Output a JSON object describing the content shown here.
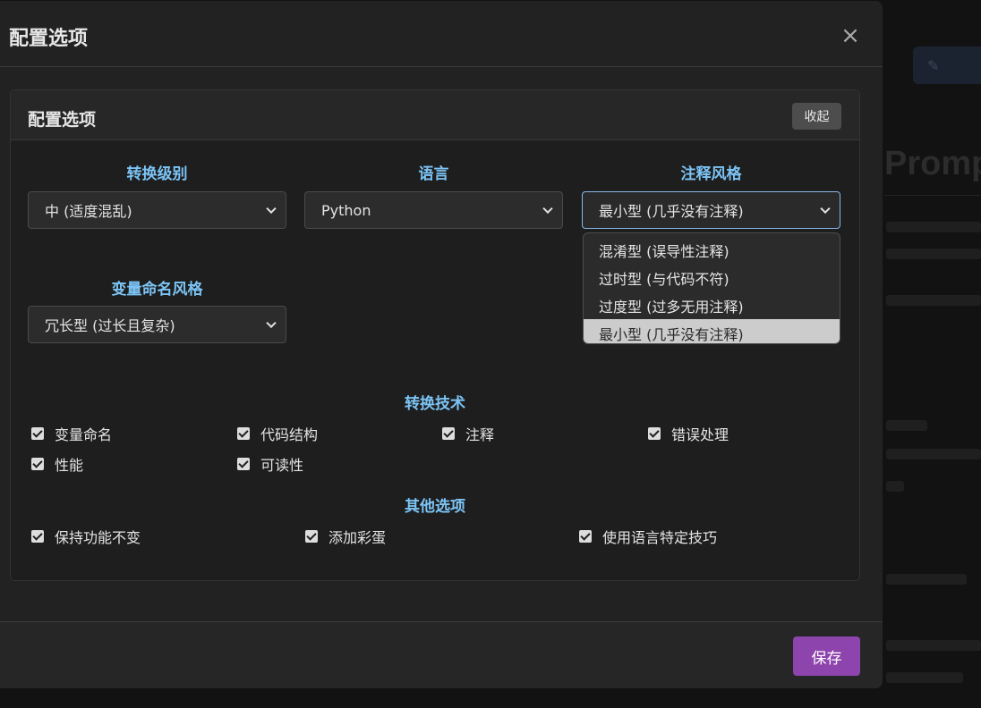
{
  "background": {
    "title_fragment": "Promp"
  },
  "modal": {
    "title": "配置选项",
    "close_label": "×",
    "card": {
      "title": "配置选项",
      "collapse_label": "收起",
      "fields": {
        "level": {
          "label": "转换级别",
          "value": "中 (适度混乱)"
        },
        "language": {
          "label": "语言",
          "value": "Python"
        },
        "comment_style": {
          "label": "注释风格",
          "value": "最小型 (几乎没有注释)",
          "options": [
            "混淆型 (误导性注释)",
            "过时型 (与代码不符)",
            "过度型 (过多无用注释)",
            "最小型 (几乎没有注释)"
          ],
          "selected_index": 3
        },
        "naming": {
          "label": "变量命名风格",
          "value": "冗长型 (过长且复杂)"
        }
      },
      "techniques": {
        "title": "转换技术",
        "items": [
          {
            "label": "变量命名",
            "checked": true
          },
          {
            "label": "代码结构",
            "checked": true
          },
          {
            "label": "注释",
            "checked": true
          },
          {
            "label": "错误处理",
            "checked": true
          },
          {
            "label": "性能",
            "checked": true
          },
          {
            "label": "可读性",
            "checked": true
          }
        ]
      },
      "other": {
        "title": "其他选项",
        "items": [
          {
            "label": "保持功能不变",
            "checked": true
          },
          {
            "label": "添加彩蛋",
            "checked": true
          },
          {
            "label": "使用语言特定技巧",
            "checked": true
          }
        ]
      }
    },
    "footer": {
      "save_label": "保存"
    }
  },
  "colors": {
    "accent_label": "#7cc4f5",
    "save_button": "#8e44ad",
    "focus_border": "#86b7e8"
  }
}
